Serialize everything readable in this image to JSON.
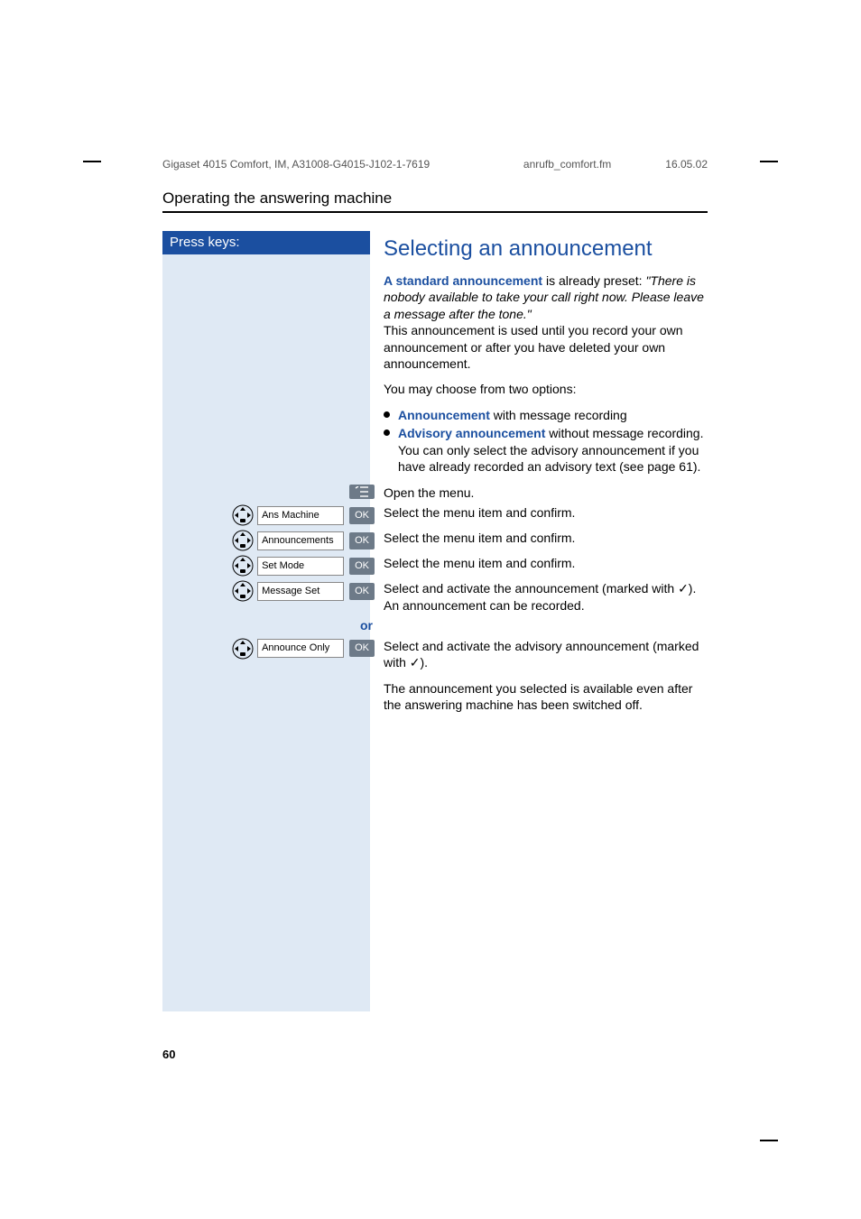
{
  "header": {
    "left": "Gigaset 4015 Comfort, IM, A31008-G4015-J102-1-7619",
    "mid": "anrufb_comfort.fm",
    "right": "16.05.02"
  },
  "section_title": "Operating the answering machine",
  "press_keys_label": "Press keys:",
  "heading": "Selecting an announcement",
  "para1_bold": "A standard announcement",
  "para1_rest_a": " is already preset: ",
  "para1_italic": "\"There is nobody available to take your call right now. Please leave a message after the tone.\"",
  "para1_rest_b": "This announcement is used until you record your own announcement or after you have deleted your own announcement.",
  "para2": "You may choose from two options:",
  "bullets": {
    "b1_bold": "Announcement",
    "b1_rest": " with message recording",
    "b2_bold": "Advisory announcement",
    "b2_rest": " without message recording.",
    "b2_sub": "You can only select the advisory announcement if you have already recorded an advisory text (see page 61)."
  },
  "steps": {
    "open_menu": "Open the menu.",
    "ans_machine_label": "Ans Machine",
    "ans_machine_desc": "Select the menu item and confirm.",
    "announcements_label": "Announcements",
    "announcements_desc": "Select the menu item and confirm.",
    "set_mode_label": "Set Mode",
    "set_mode_desc": "Select the menu item and confirm.",
    "message_set_label": "Message Set",
    "message_set_desc_a": "Select and activate the announcement (marked with ✓).",
    "message_set_desc_b": "An announcement can be recorded.",
    "or_label": "or",
    "announce_only_label": "Announce Only",
    "announce_only_desc": "Select and activate the advisory announcement (marked with ✓).",
    "final": "The announcement you selected is available even after the answering machine has been switched off.",
    "ok": "OK"
  },
  "page_number": "60"
}
